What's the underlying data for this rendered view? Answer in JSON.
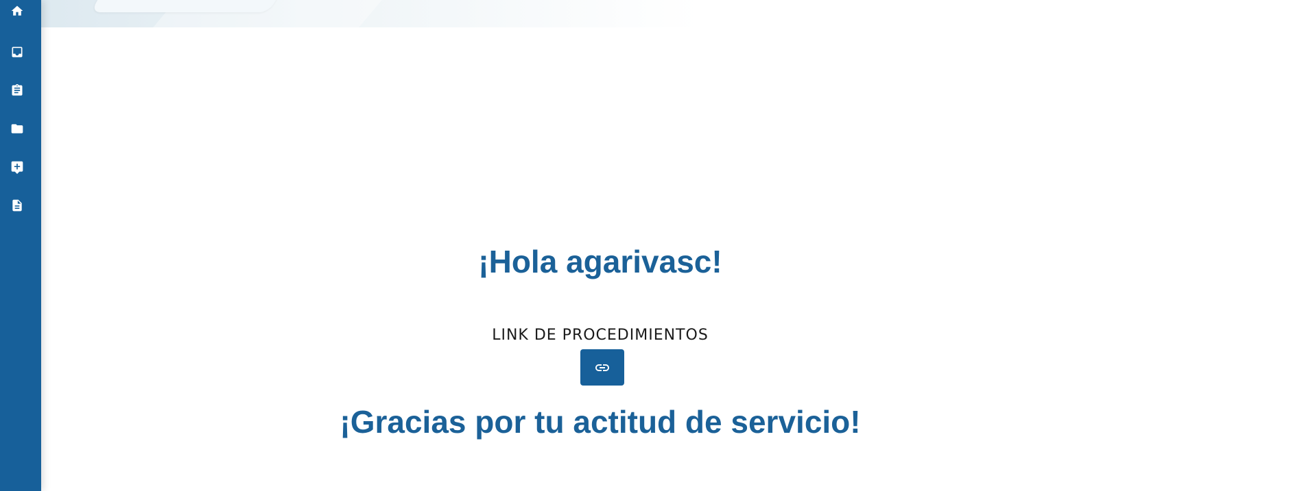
{
  "sidebar": {
    "items": [
      {
        "icon": "home-icon"
      },
      {
        "icon": "inbox-icon"
      },
      {
        "icon": "clipboard-icon"
      },
      {
        "icon": "folder-icon"
      },
      {
        "icon": "add-comment-icon"
      },
      {
        "icon": "document-icon"
      }
    ]
  },
  "main": {
    "greeting": "¡Hola agarivasc!",
    "link_label": "LINK DE PROCEDIMIENTOS",
    "link_button_icon": "link-icon",
    "thanks": "¡Gracias por tu actitud de servicio!"
  },
  "colors": {
    "sidebar": "#17609a",
    "heading": "#1b6198",
    "button": "#17609a"
  }
}
